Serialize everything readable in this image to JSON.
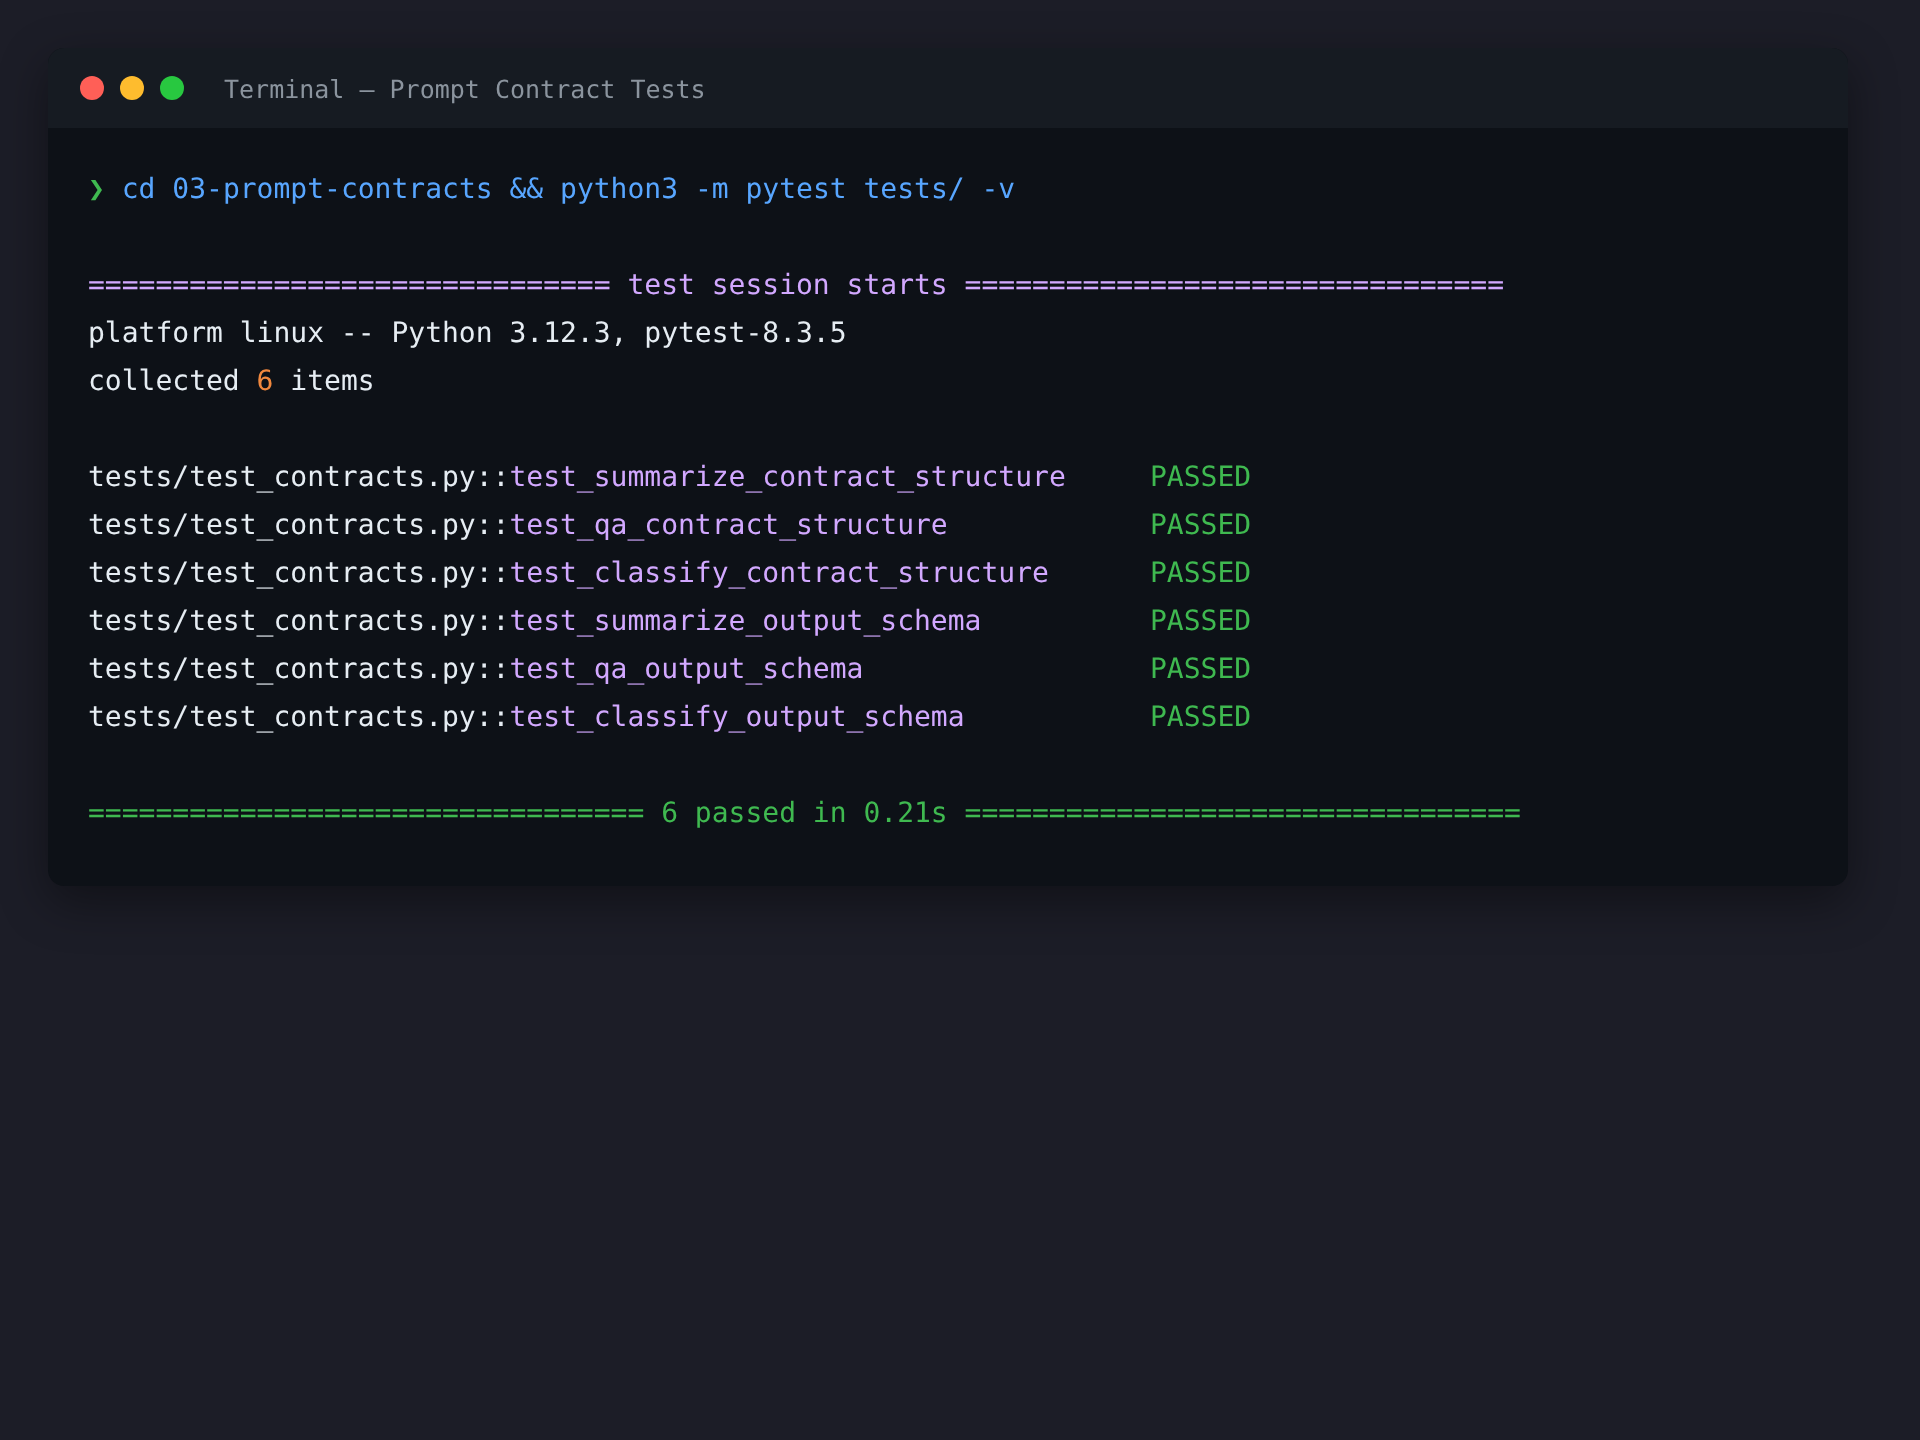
{
  "window": {
    "title": "Terminal — Prompt Contract Tests"
  },
  "prompt": {
    "symbol": "❯",
    "command": "cd 03-prompt-contracts && python3 -m pytest tests/ -v"
  },
  "session_header": "=============================== test session starts ================================",
  "platform": "platform linux -- Python 3.12.3, pytest-8.3.5",
  "collected": {
    "prefix": "collected ",
    "count": "6",
    "suffix": " items"
  },
  "tests": [
    {
      "file": "tests/test_contracts.py::",
      "name": "test_summarize_contract_structure",
      "status": "PASSED"
    },
    {
      "file": "tests/test_contracts.py::",
      "name": "test_qa_contract_structure",
      "status": "PASSED"
    },
    {
      "file": "tests/test_contracts.py::",
      "name": "test_classify_contract_structure",
      "status": "PASSED"
    },
    {
      "file": "tests/test_contracts.py::",
      "name": "test_summarize_output_schema",
      "status": "PASSED"
    },
    {
      "file": "tests/test_contracts.py::",
      "name": "test_qa_output_schema",
      "status": "PASSED"
    },
    {
      "file": "tests/test_contracts.py::",
      "name": "test_classify_output_schema",
      "status": "PASSED"
    }
  ],
  "summary": "================================= 6 passed in 0.21s ================================="
}
